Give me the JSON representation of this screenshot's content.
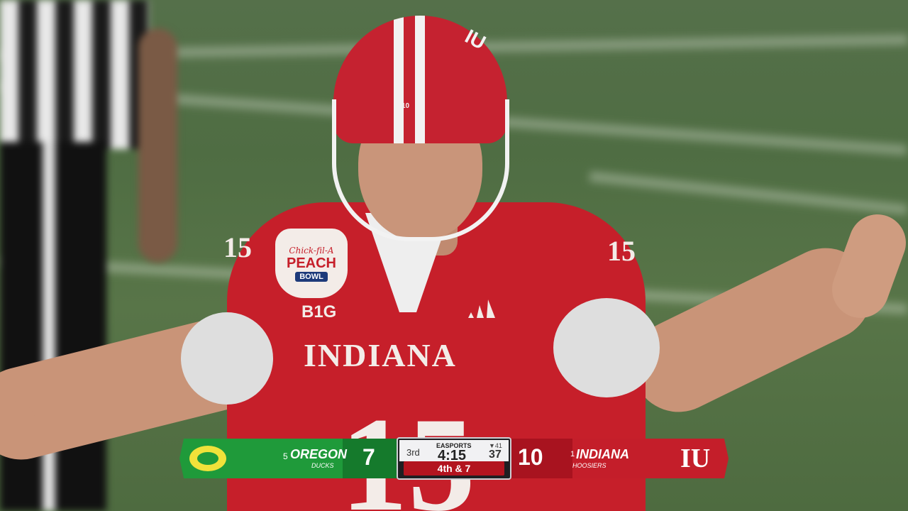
{
  "scene": {
    "jersey_text": "INDIANA",
    "jersey_number": "15",
    "sleeve_number": "15",
    "helmet_number": "10",
    "helmet_logo": "IU",
    "conference_logo": "B1G",
    "bowl_patch": {
      "top": "Chick-fil-A",
      "middle": "PEACH",
      "bottom": "BOWL"
    }
  },
  "scoreboard": {
    "away": {
      "rank": "5",
      "name": "OREGON",
      "mascot": "DUCKS",
      "score": "7",
      "color": "#1f9a3a"
    },
    "home": {
      "rank": "1",
      "name": "INDIANA",
      "mascot": "HOOSIERS",
      "score": "10",
      "logo": "IU",
      "color": "#c41e2a"
    },
    "center": {
      "brand": "EASPORTS",
      "quarter": "3rd",
      "clock": "4:15",
      "timeouts": "▼41",
      "play_clock": "37",
      "down_distance": "4th & 7"
    }
  }
}
